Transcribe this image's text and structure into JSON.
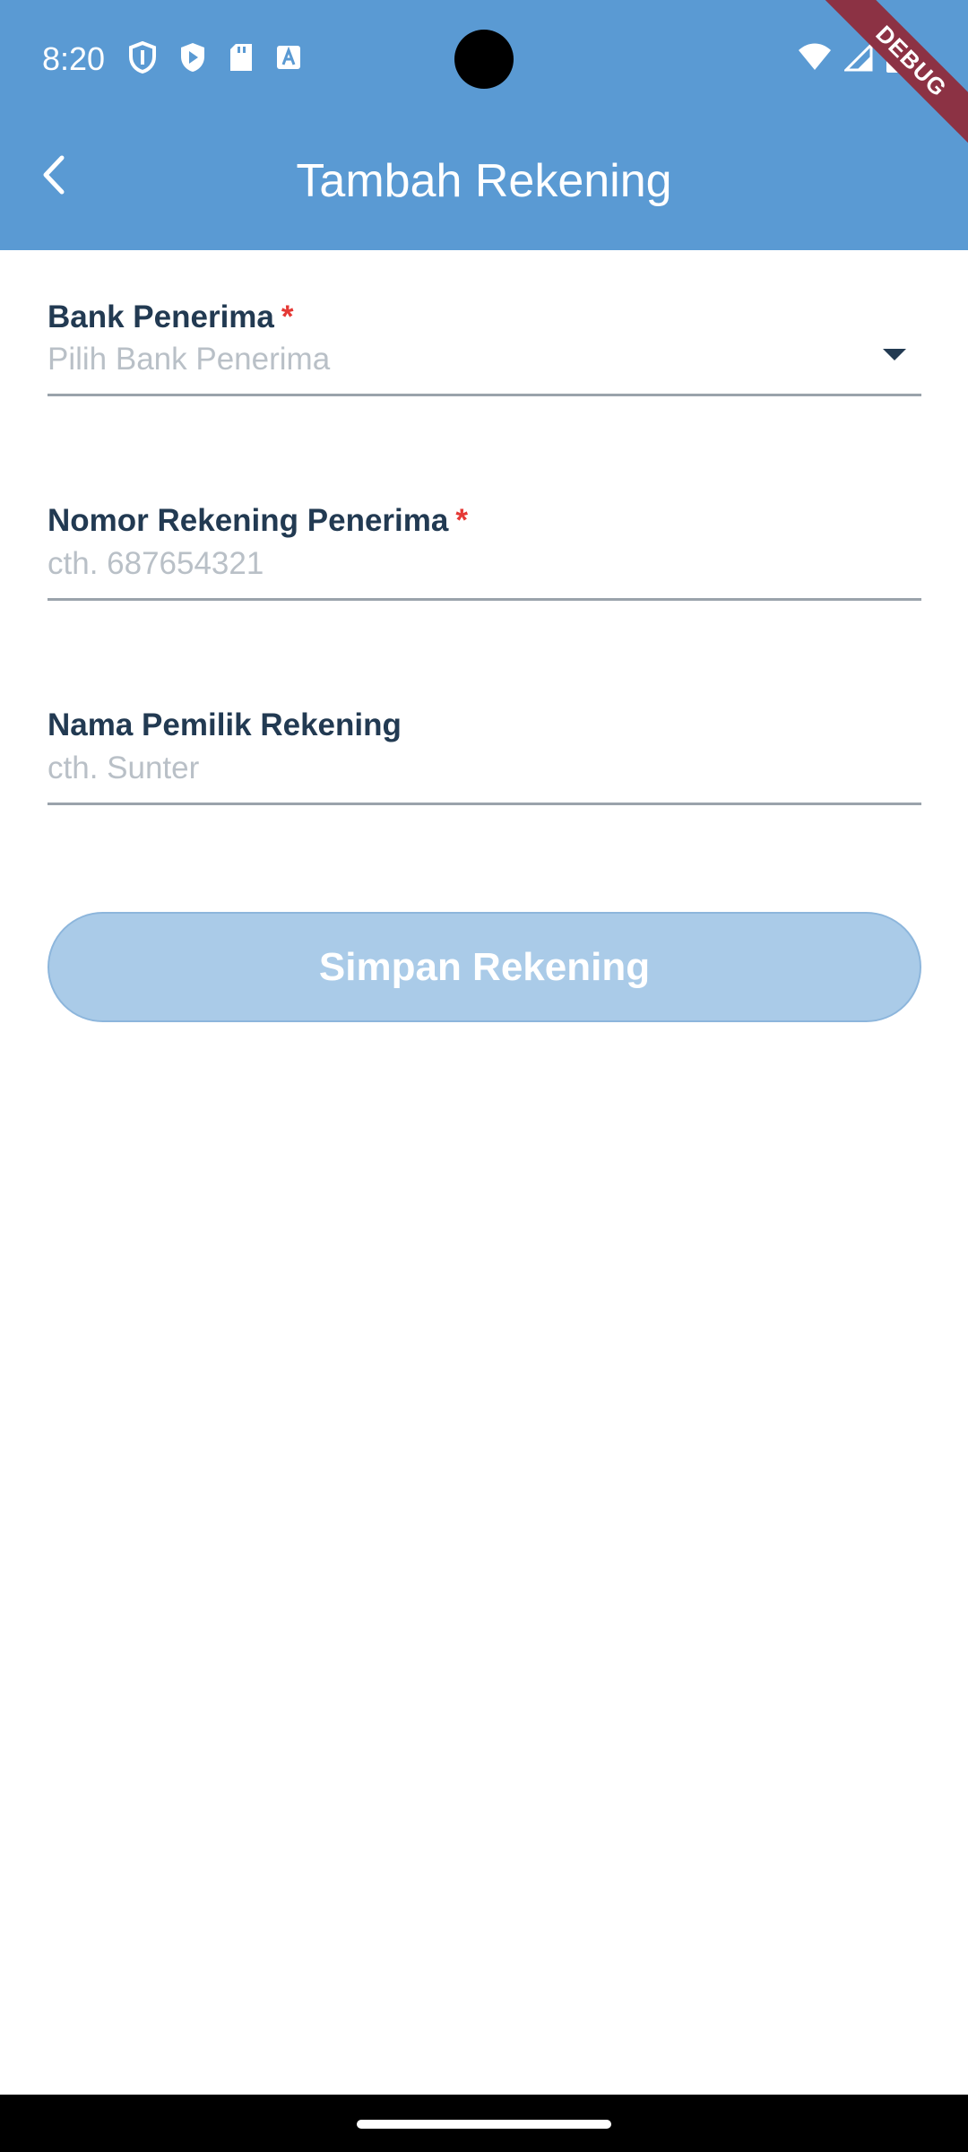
{
  "status_bar": {
    "time": "8:20",
    "left_icons": [
      "shield-icon",
      "play-protect-icon",
      "sd-card-icon",
      "font-a-icon"
    ],
    "right_icons": [
      "wifi-icon",
      "signal-icon",
      "battery-icon"
    ]
  },
  "debug_banner": "DEBUG",
  "app_bar": {
    "title": "Tambah Rekening",
    "back_icon": "chevron-left-icon",
    "background_color": "#5a9ad3"
  },
  "form": {
    "bank": {
      "label": "Bank Penerima",
      "required_mark": "*",
      "placeholder": "Pilih Bank Penerima",
      "icon": "dropdown-caret-icon"
    },
    "account_number": {
      "label": "Nomor Rekening Penerima",
      "required_mark": "*",
      "placeholder": "cth. 687654321"
    },
    "account_name": {
      "label": "Nama Pemilik Rekening",
      "placeholder": "cth. Sunter"
    }
  },
  "save_button": {
    "label": "Simpan Rekening",
    "state": "disabled"
  },
  "colors": {
    "label_text": "#223a52",
    "required": "#e53935",
    "placeholder": "#b9c0c7",
    "button_disabled": "#aacbe8"
  }
}
